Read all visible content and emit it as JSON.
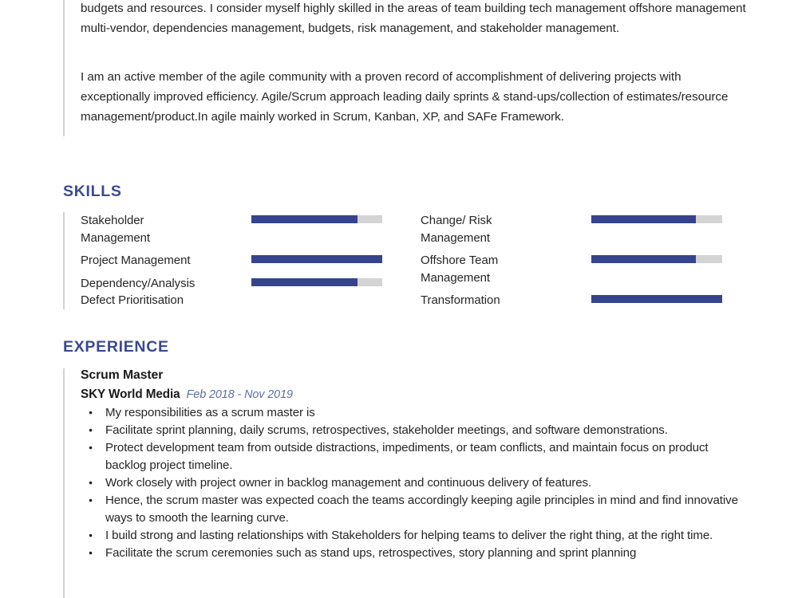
{
  "document": {
    "type": "resume",
    "accent_color": "#3b4a91",
    "bar_fill_color": "#36448c",
    "bar_track_color": "#d4d4d4",
    "divider_color": "#d3d3d3"
  },
  "summary": {
    "paragraphs": [
      "budgets and resources. I consider myself highly skilled in the areas of team building tech management offshore management multi-vendor, dependencies management, budgets, risk management, and stakeholder management.",
      "I am an active member of the agile community with a proven record of accomplishment of delivering projects with exceptionally improved efficiency. Agile/Scrum approach leading daily sprints & stand-ups/collection of estimates/resource management/product.In agile mainly worked in Scrum, Kanban, XP, and SAFe Framework."
    ]
  },
  "skills": {
    "heading": "SKILLS",
    "left_column": [
      {
        "lines": [
          "Stakeholder",
          "Management"
        ],
        "label": "Stakeholder Management",
        "level_percent": 81,
        "has_bar": true
      },
      {
        "lines": [
          "Project Management"
        ],
        "label": "Project Management",
        "level_percent": 100,
        "has_bar": true
      },
      {
        "lines": [
          "Dependency/Analysis",
          "Defect Prioritisation"
        ],
        "label": "Dependency/Analysis Defect Prioritisation",
        "level_percent": 81,
        "has_bar": true
      }
    ],
    "right_column": [
      {
        "lines": [
          "Change/ Risk",
          "Management"
        ],
        "label": "Change/ Risk Management",
        "level_percent": 80,
        "has_bar": true
      },
      {
        "lines": [
          "Offshore Team",
          "Management"
        ],
        "label": "Offshore Team Management",
        "level_percent": 80,
        "has_bar": true
      },
      {
        "lines": [
          "Transformation"
        ],
        "label": "Transformation",
        "level_percent": 100,
        "has_bar": true
      }
    ]
  },
  "experience": {
    "heading": "EXPERIENCE",
    "entries": [
      {
        "title": "Scrum Master",
        "company": "SKY World Media",
        "dates": "Feb 2018 - Nov 2019",
        "bullets": [
          "My responsibilities as a scrum master is",
          " Facilitate sprint planning, daily scrums, retrospectives, stakeholder meetings, and software demonstrations.",
          "Protect development team from outside distractions, impediments, or team conflicts, and maintain focus on product backlog project timeline.",
          "Work closely with project owner in backlog management and continuous delivery of features.",
          "Hence, the scrum master was expected coach the teams accordingly keeping agile principles in mind and find innovative ways to smooth the learning curve.",
          "I build strong and lasting relationships with Stakeholders for helping teams to deliver the right thing, at the right time.",
          "Facilitate the scrum ceremonies such as stand ups, retrospectives, story planning and sprint planning"
        ]
      }
    ]
  }
}
